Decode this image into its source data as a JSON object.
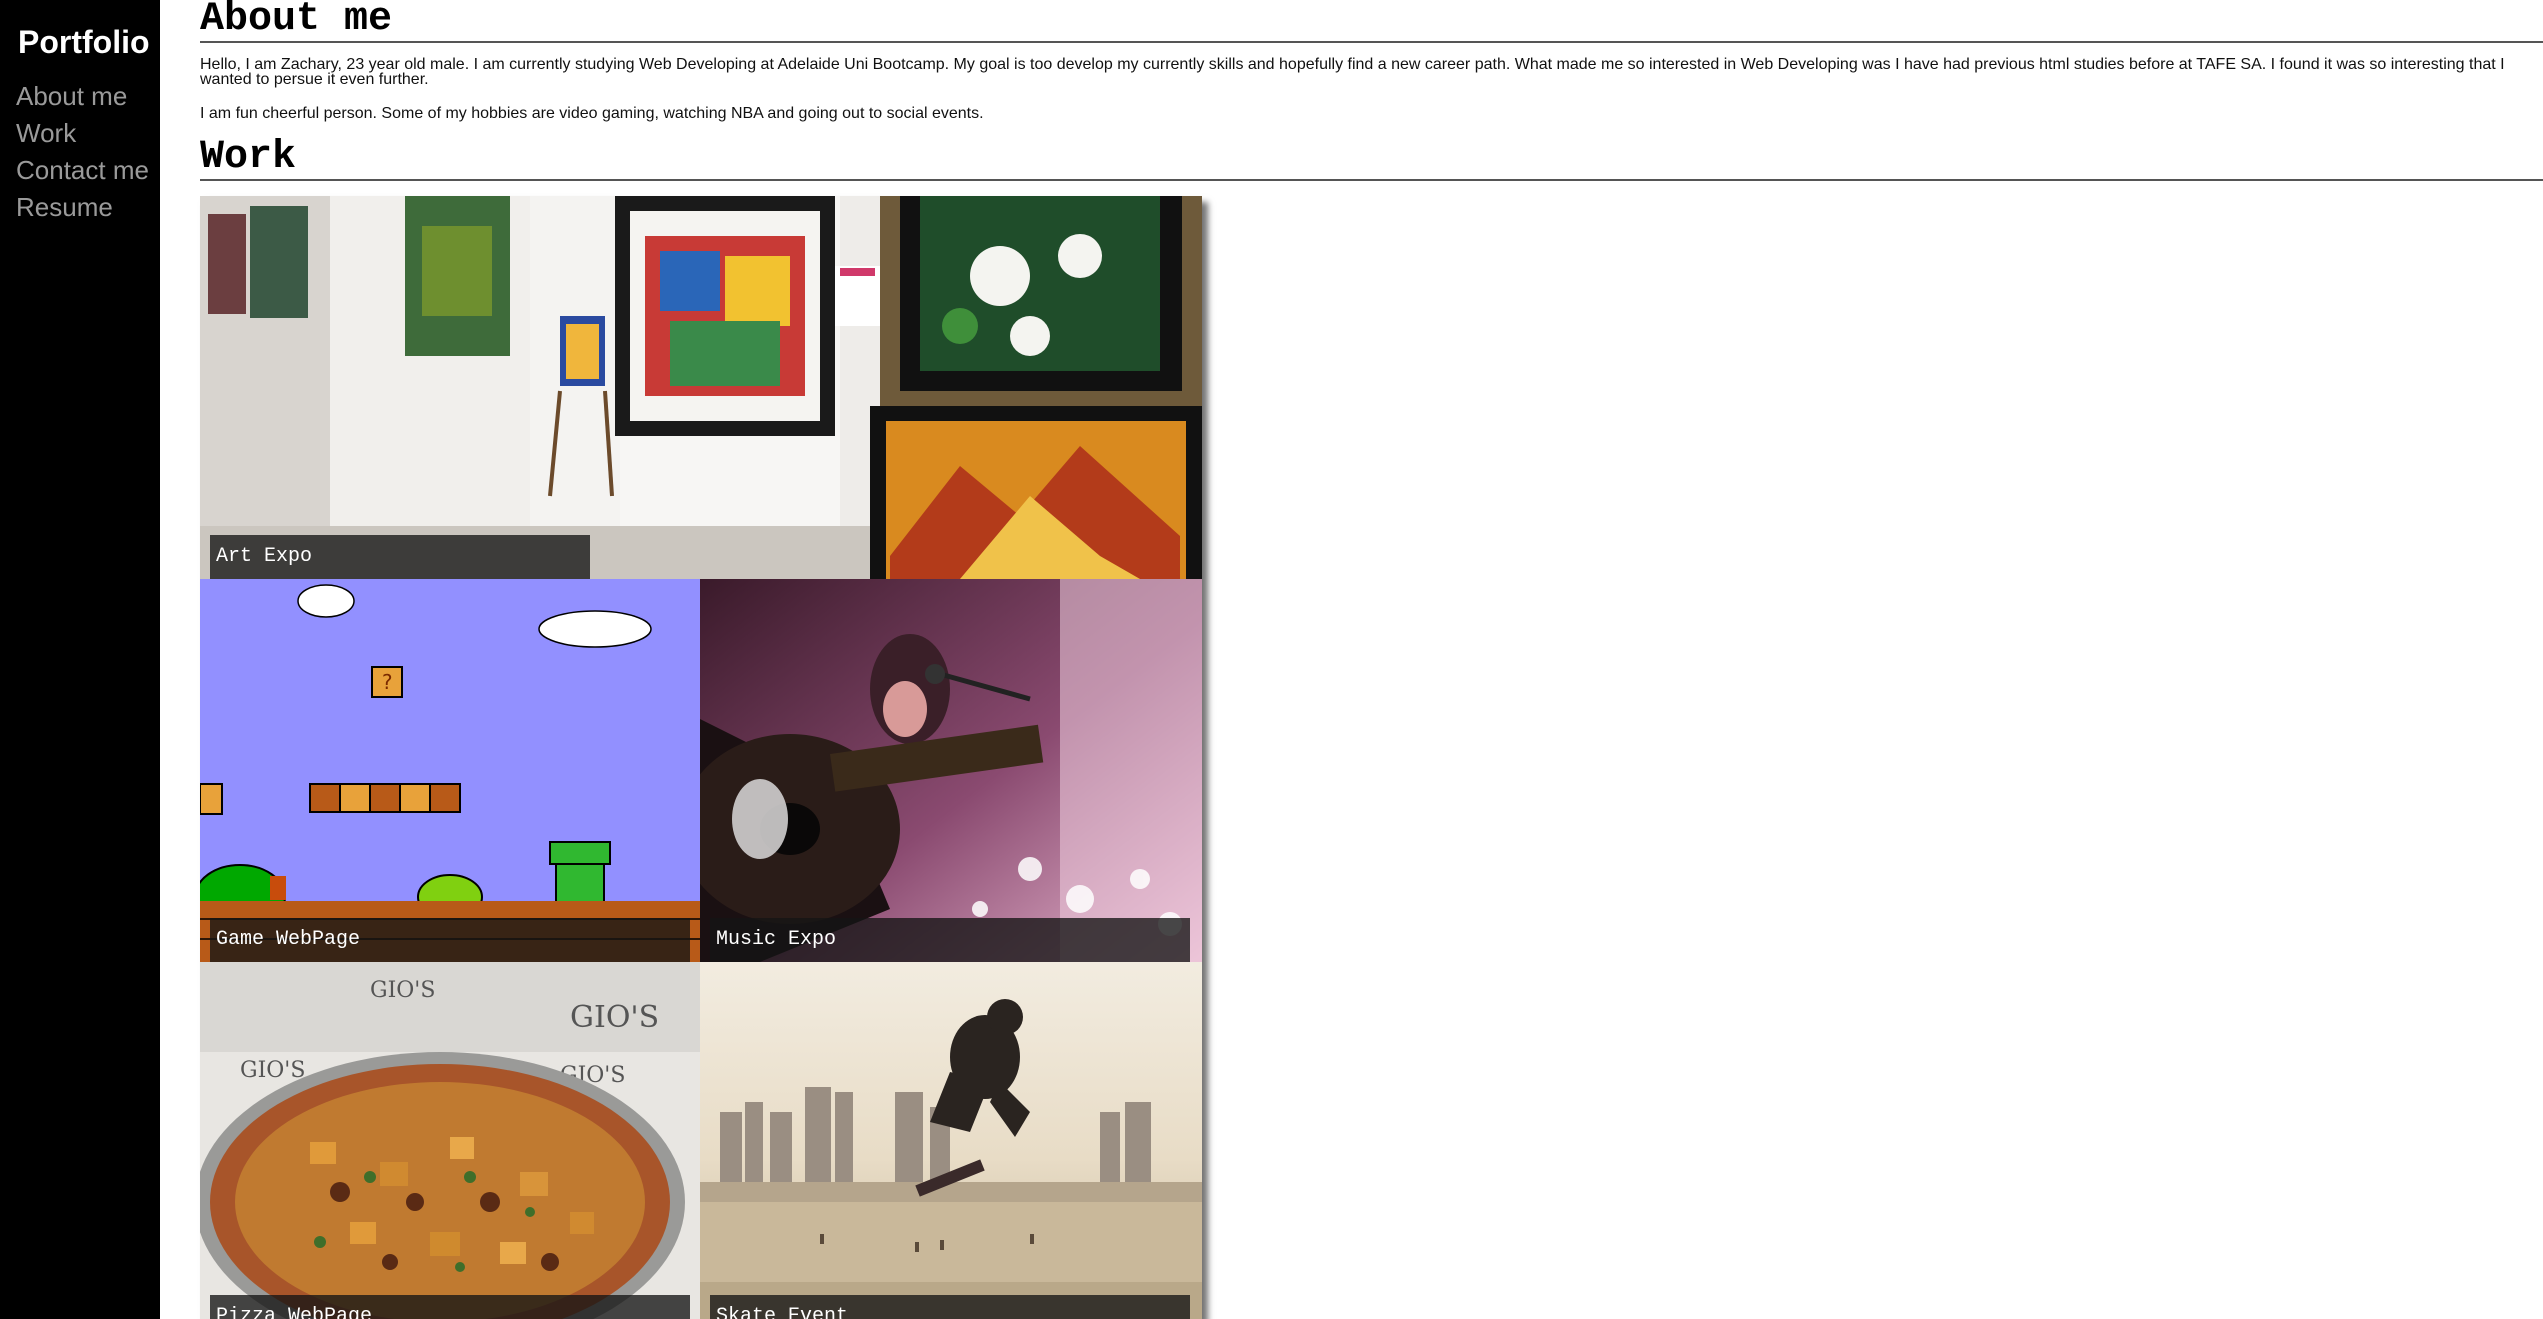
{
  "sidebar": {
    "brand": "Portfolio",
    "items": [
      {
        "label": "About me"
      },
      {
        "label": "Work"
      },
      {
        "label": "Contact me"
      },
      {
        "label": "Resume"
      }
    ],
    "background": "#000000",
    "link_color": "#9a9a9a"
  },
  "about": {
    "title": "About me",
    "paragraphs": [
      "Hello, I am Zachary, 23 year old male. I am currently studying Web Developing at Adelaide Uni Bootcamp. My goal is too develop my currently skills and hopefully find a new career path. What made me so interested in Web Developing was I have had previous html studies before at TAFE SA. I found it was so interesting that I wanted to persue it even further.",
      "I am fun cheerful person. Some of my hobbies are video gaming, watching NBA and going out to social events."
    ]
  },
  "work": {
    "title": "Work",
    "projects": [
      {
        "caption": "Art Expo",
        "image": "art-gallery-image"
      },
      {
        "caption": "Game WebPage",
        "image": "mario-level-image"
      },
      {
        "caption": "Music Expo",
        "image": "guitar-singer-image"
      },
      {
        "caption": "Pizza WebPage",
        "image": "pizza-image"
      },
      {
        "caption": "Skate Event",
        "image": "skateboarder-image"
      }
    ]
  }
}
